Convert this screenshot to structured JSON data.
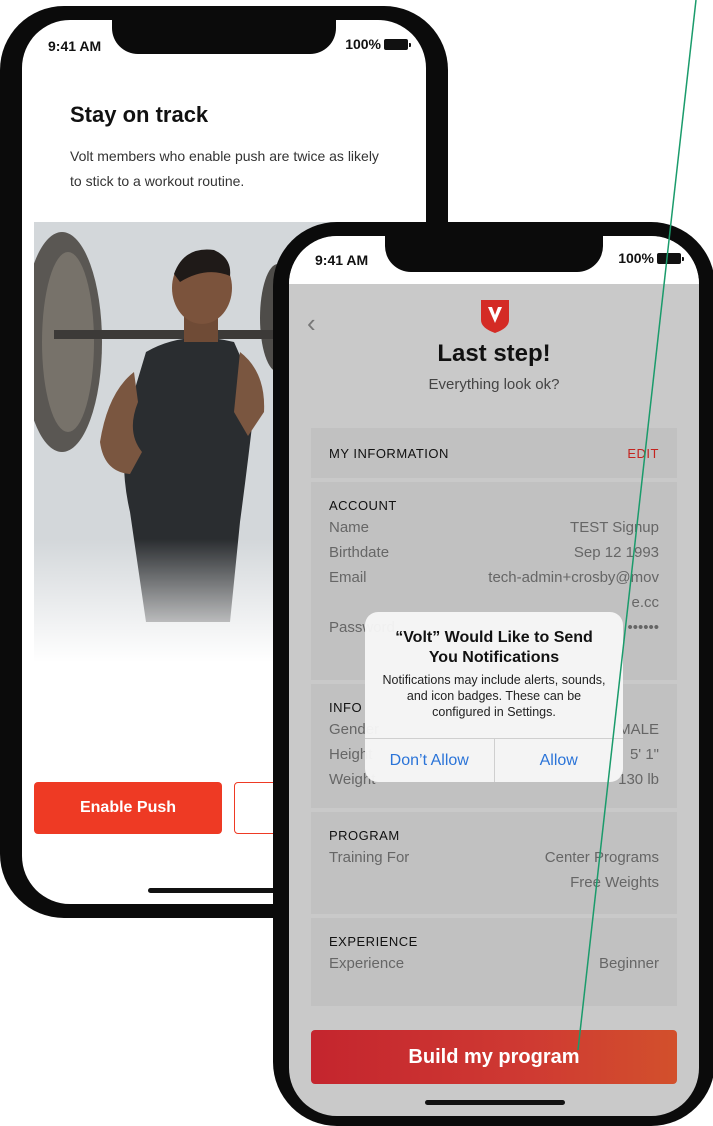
{
  "phone1": {
    "status": {
      "time": "9:41 AM",
      "battery": "100%"
    },
    "title": "Stay on track",
    "description": "Volt members who enable push are twice as likely to stick to a workout routine.",
    "enable_push_label": "Enable Push"
  },
  "phone2": {
    "status": {
      "time": "9:41 AM",
      "battery": "100%"
    },
    "title": "Last step!",
    "subtitle": "Everything look ok?",
    "my_information": {
      "label": "MY INFORMATION",
      "edit": "EDIT"
    },
    "account": {
      "title": "ACCOUNT",
      "rows": [
        {
          "label": "Name",
          "value": "TEST Signup"
        },
        {
          "label": "Birthdate",
          "value": "Sep 12 1993"
        },
        {
          "label": "Email",
          "value": "tech-admin+crosby@move.cc"
        },
        {
          "label": "Password",
          "value": "••••••"
        }
      ]
    },
    "info": {
      "title": "INFO",
      "rows": [
        {
          "label": "Gender",
          "value": "MALE"
        },
        {
          "label": "Height",
          "value": "5' 1\""
        },
        {
          "label": "Weight",
          "value": "130 lb"
        }
      ]
    },
    "program": {
      "title": "PROGRAM",
      "label": "Training For",
      "values": [
        "Center Programs",
        "Free Weights"
      ]
    },
    "experience": {
      "title": "EXPERIENCE",
      "label": "Experience",
      "value": "Beginner"
    },
    "cta_label": "Build my program",
    "dialog": {
      "title": "“Volt” Would Like to Send You Notifications",
      "message": "Notifications may include alerts, sounds, and icon badges. These can be configured in Settings.",
      "dont_allow": "Don’t Allow",
      "allow": "Allow"
    }
  },
  "colors": {
    "accent": "#ee3a24",
    "cta_start": "#c4252e",
    "cta_end": "#d2502c",
    "edit": "#c4241f",
    "ios_blue": "#2b74d8",
    "guide_line": "#1a9b6b"
  }
}
